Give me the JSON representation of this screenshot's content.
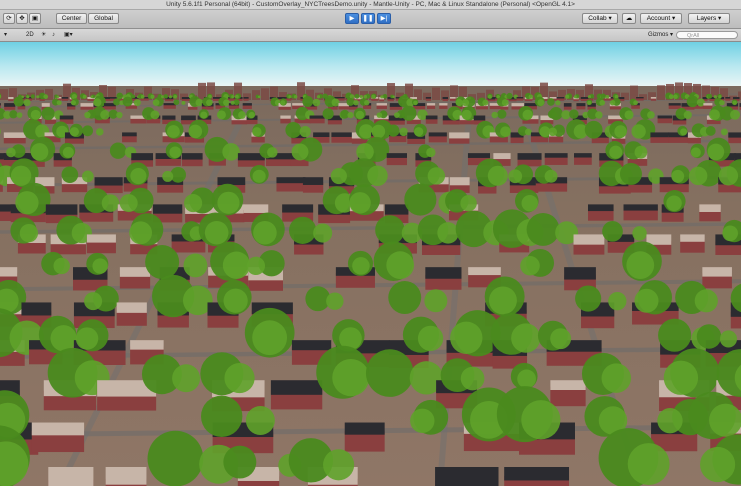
{
  "window": {
    "title": "Unity 5.6.1f1 Personal (64bit) - CustomOverlay_NYCTreesDemo.unity - Mantle-Unity - PC, Mac & Linux Standalone (Personal) <OpenGL 4.1>"
  },
  "toolbar": {
    "center_label": "Center",
    "global_label": "Global",
    "collab_label": "Collab",
    "account_label": "Account",
    "layers_label": "Layers",
    "play_pressed": true,
    "icons": [
      "refresh-icon",
      "move-icon",
      "rect-tool-icon",
      "play-icon",
      "pause-icon",
      "step-icon",
      "cloud-icon"
    ]
  },
  "scene_bar": {
    "mode_label": "2D",
    "gizmos_label": "Gizmos",
    "search_placeholder": "QrAll"
  },
  "colors": {
    "play_active": "#2f6fc4",
    "roof_dark": "#2b2b30",
    "roof_light": "#c7b5a8",
    "brick": "#8a3f3f",
    "tree": "#4a8a1e",
    "sky": "#8fdde9"
  }
}
